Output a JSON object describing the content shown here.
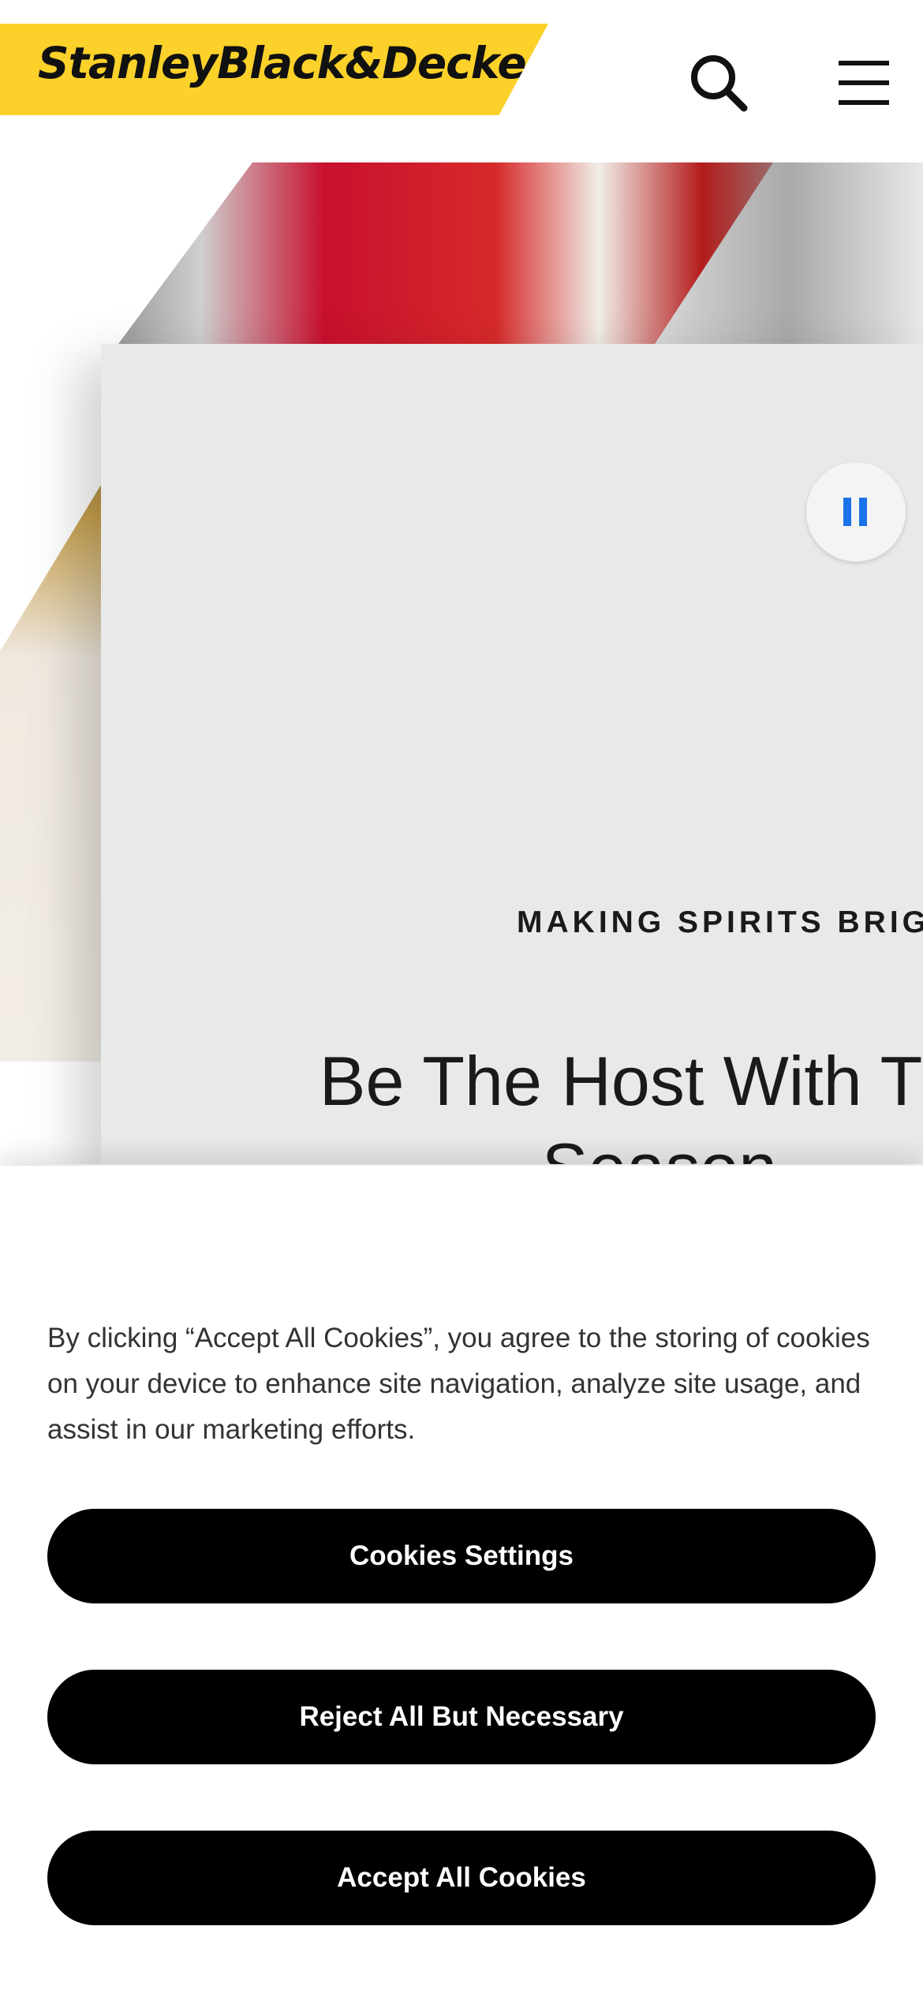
{
  "header": {
    "logo_text": "StanleyBlack&Decker",
    "search_icon": "search-icon",
    "menu_icon": "hamburger-menu-icon",
    "brand_color": "#fcd12a"
  },
  "hero": {
    "eyebrow": "MAKING SPIRITS BRIG",
    "title": "Be The Host With The Season",
    "pause_icon": "pause-icon",
    "pause_color": "#1a73e8",
    "cta_color": "#f5c518"
  },
  "cookie_banner": {
    "text": "By clicking “Accept All Cookies”, you agree to the storing of cookies on your device to enhance site navigation, analyze site usage, and assist in our marketing efforts.",
    "settings_label": "Cookies Settings",
    "reject_label": "Reject All But Necessary",
    "accept_label": "Accept All Cookies"
  }
}
